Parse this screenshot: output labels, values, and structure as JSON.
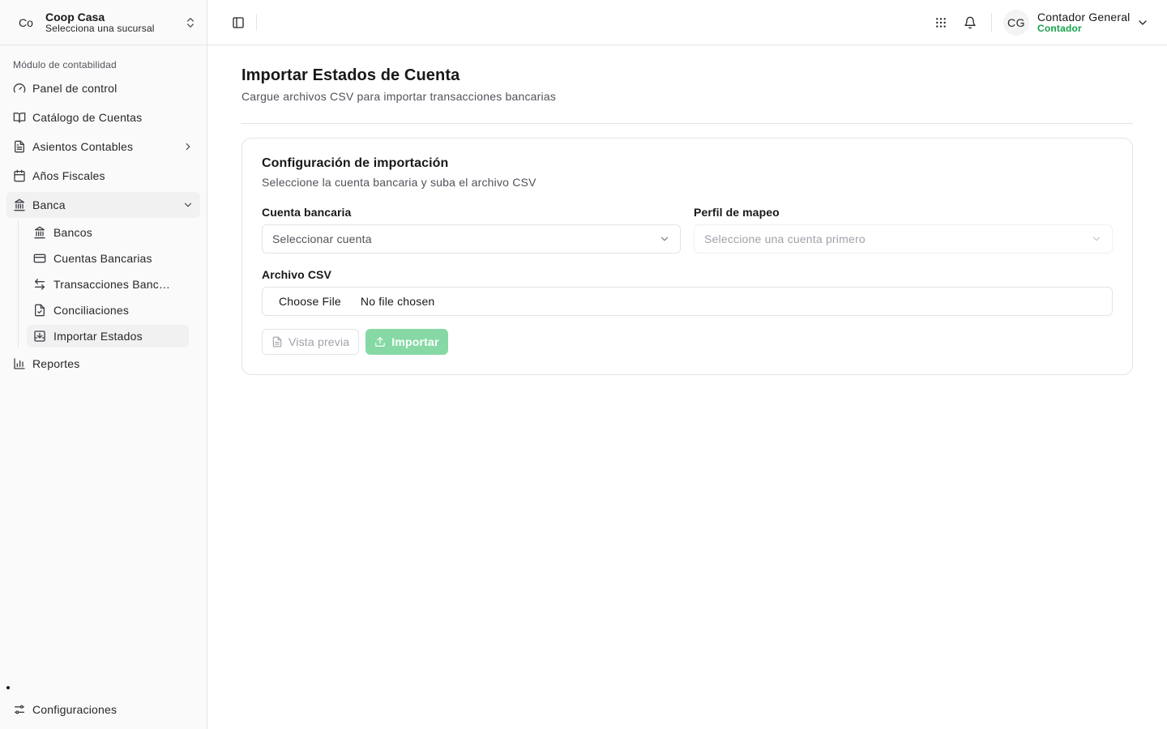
{
  "org": {
    "avatar": "Co",
    "name": "Coop Casa",
    "subtitle": "Selecciona una sucursal"
  },
  "sidebar": {
    "section_label": "Módulo de contabilidad",
    "items": [
      {
        "label": "Panel de control",
        "icon": "gauge-icon"
      },
      {
        "label": "Catálogo de Cuentas",
        "icon": "book-open-icon"
      },
      {
        "label": "Asientos Contables",
        "icon": "file-text-icon"
      },
      {
        "label": "Años Fiscales",
        "icon": "calendar-icon"
      },
      {
        "label": "Banca",
        "icon": "landmark-icon"
      },
      {
        "label": "Reportes",
        "icon": "bar-chart-icon"
      }
    ],
    "banca_sub": [
      {
        "label": "Bancos",
        "icon": "landmark-icon"
      },
      {
        "label": "Cuentas Bancarias",
        "icon": "credit-card-icon"
      },
      {
        "label": "Transacciones Bancarias",
        "icon": "arrows-left-right-icon"
      },
      {
        "label": "Conciliaciones",
        "icon": "file-check-icon"
      },
      {
        "label": "Importar Estados",
        "icon": "import-icon"
      }
    ],
    "settings_label": "Configuraciones"
  },
  "topbar": {
    "user": {
      "initials": "CG",
      "name": "Contador General",
      "role": "Contador"
    }
  },
  "page": {
    "title": "Importar Estados de Cuenta",
    "subtitle": "Cargue archivos CSV para importar transacciones bancarias"
  },
  "card": {
    "title": "Configuración de importación",
    "subtitle": "Seleccione la cuenta bancaria y suba el archivo CSV",
    "bank_account": {
      "label": "Cuenta bancaria",
      "placeholder": "Seleccionar cuenta"
    },
    "mapping_profile": {
      "label": "Perfil de mapeo",
      "placeholder": "Seleccione una cuenta primero"
    },
    "csv": {
      "label": "Archivo CSV",
      "button": "Choose File",
      "status": "No file chosen"
    },
    "actions": {
      "preview": "Vista previa",
      "import": "Importar"
    }
  },
  "colors": {
    "accent": "#16a34a",
    "primary_disabled": "#86d9a5",
    "sidebar_bg": "#fafafa",
    "border": "#e4e4e7"
  }
}
